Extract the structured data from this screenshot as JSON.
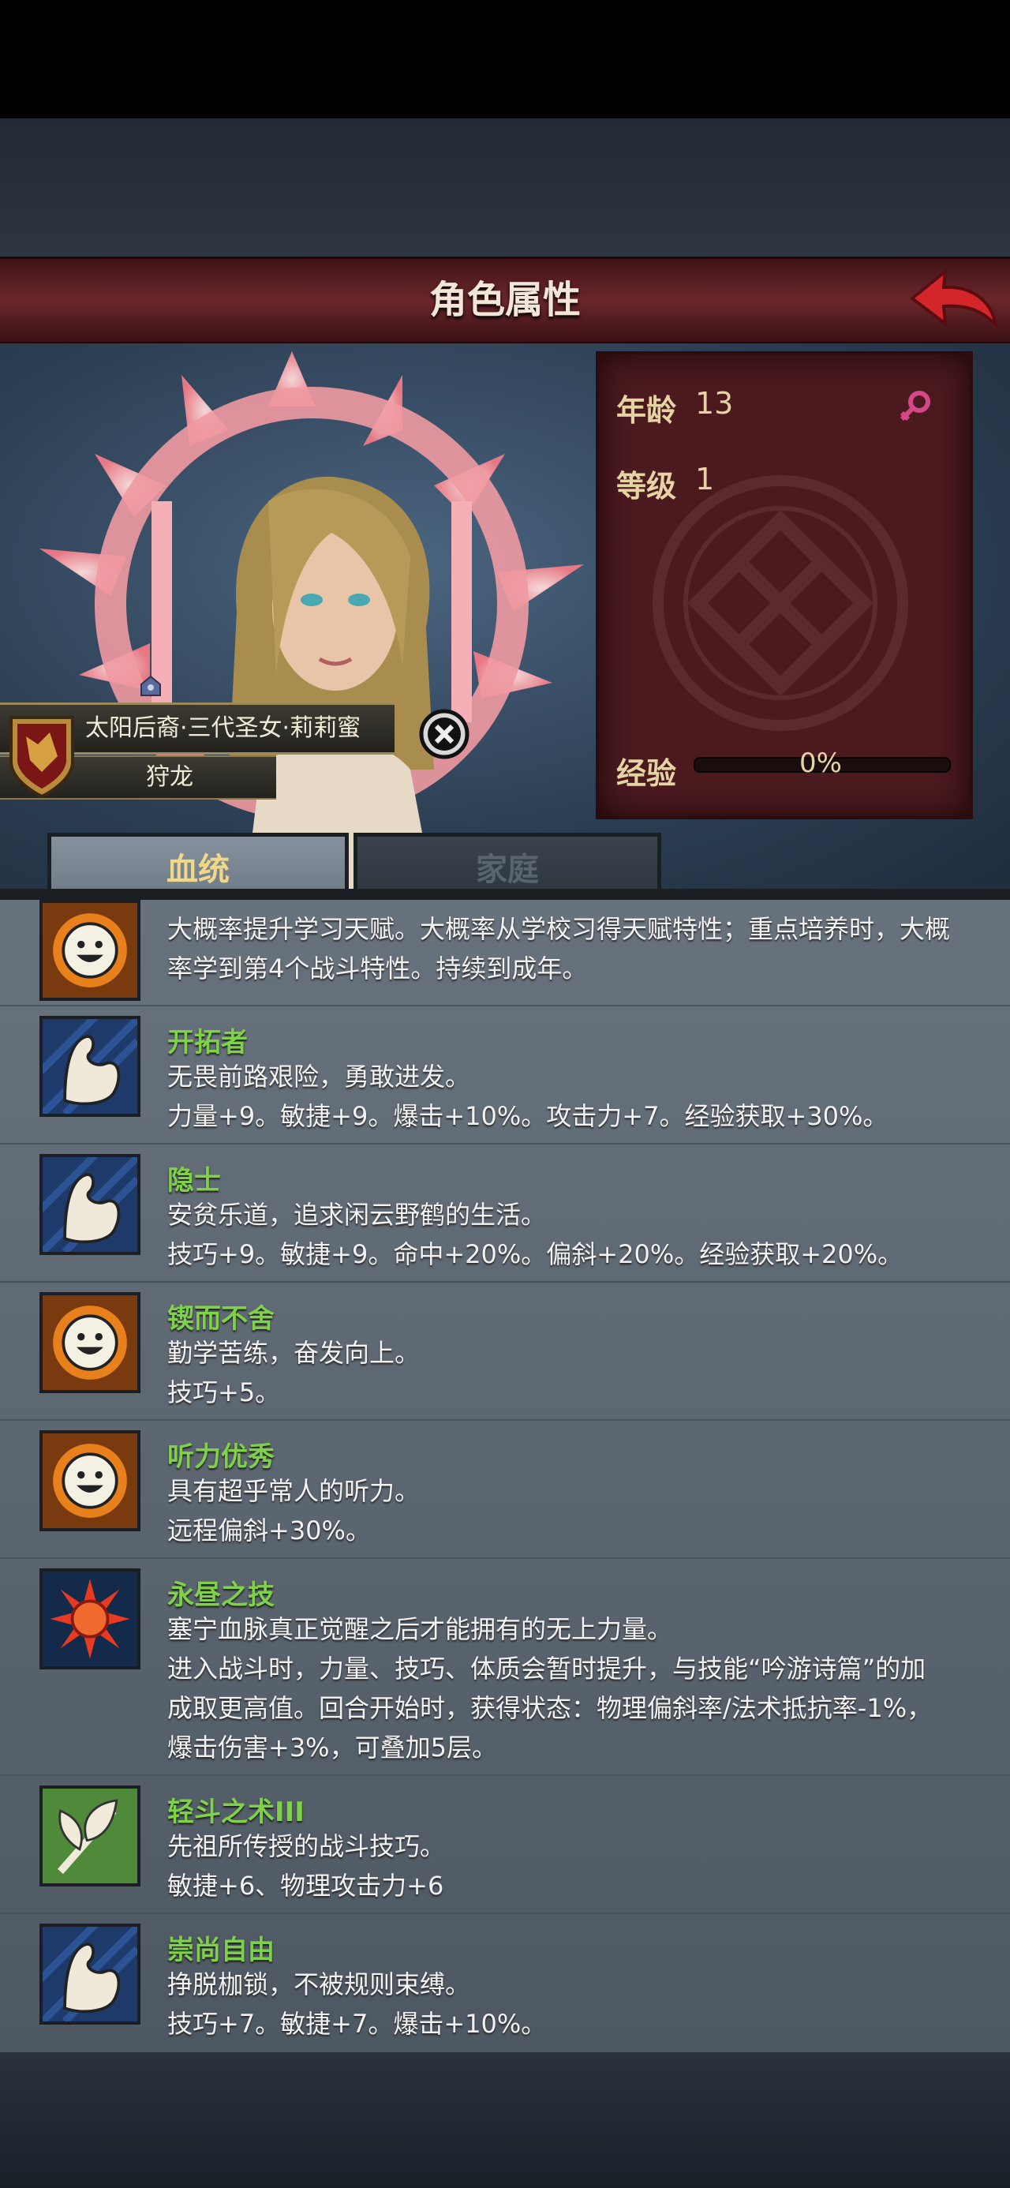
{
  "header": {
    "title": "角色属性",
    "back_icon": "back-arrow-icon"
  },
  "character": {
    "name": "太阳后裔·三代圣女·莉莉蜜",
    "class": "狩龙",
    "emblem_icon": "wolf-crest-icon",
    "gender_icon": "female-icon"
  },
  "stats": {
    "age_label": "年龄",
    "age_value": "13",
    "level_label": "等级",
    "level_value": "1",
    "exp_label": "经验",
    "exp_value": "0%",
    "exp_fraction": 0
  },
  "tabs": [
    {
      "label": "血统",
      "active": true
    },
    {
      "label": "家庭",
      "active": false
    }
  ],
  "traits": [
    {
      "title": "",
      "icon": "smiley-sun-icon",
      "desc": [
        "大概率提升学习天赋。大概率从学校习得天赋特性；重点培养时，大概",
        "率学到第4个战斗特性。持续到成年。"
      ]
    },
    {
      "title": "开拓者",
      "icon": "flexed-arm-icon",
      "desc": [
        "无畏前路艰险，勇敢进发。",
        "力量+9。敏捷+9。爆击+10%。攻击力+7。经验获取+30%。"
      ]
    },
    {
      "title": "隐士",
      "icon": "flexed-arm-icon",
      "desc": [
        "安贫乐道，追求闲云野鹤的生活。",
        "技巧+9。敏捷+9。命中+20%。偏斜+20%。经验获取+20%。"
      ]
    },
    {
      "title": "锲而不舍",
      "icon": "smiley-sun-icon",
      "desc": [
        "勤学苦练，奋发向上。",
        "技巧+5。"
      ]
    },
    {
      "title": "听力优秀",
      "icon": "smiley-sun-icon",
      "desc": [
        "具有超乎常人的听力。",
        "远程偏斜+30%。"
      ]
    },
    {
      "title": "永昼之技",
      "icon": "red-sun-sigil-icon",
      "desc": [
        "塞宁血脉真正觉醒之后才能拥有的无上力量。",
        "进入战斗时，力量、技巧、体质会暂时提升，与技能“吟游诗篇”的加",
        "成取更高值。回合开始时，获得状态：物理偏斜率/法术抵抗率-1%，",
        "爆击伤害+3%，可叠加5层。"
      ]
    },
    {
      "title": "轻斗之术III",
      "icon": "leaf-branch-icon",
      "desc": [
        "先祖所传授的战斗技巧。",
        "敏捷+6、物理攻击力+6"
      ]
    },
    {
      "title": "崇尚自由",
      "icon": "flexed-arm-icon",
      "desc": [
        "挣脱枷锁，不被规则束缚。",
        "技巧+7。敏捷+7。爆击+10%。"
      ]
    }
  ]
}
